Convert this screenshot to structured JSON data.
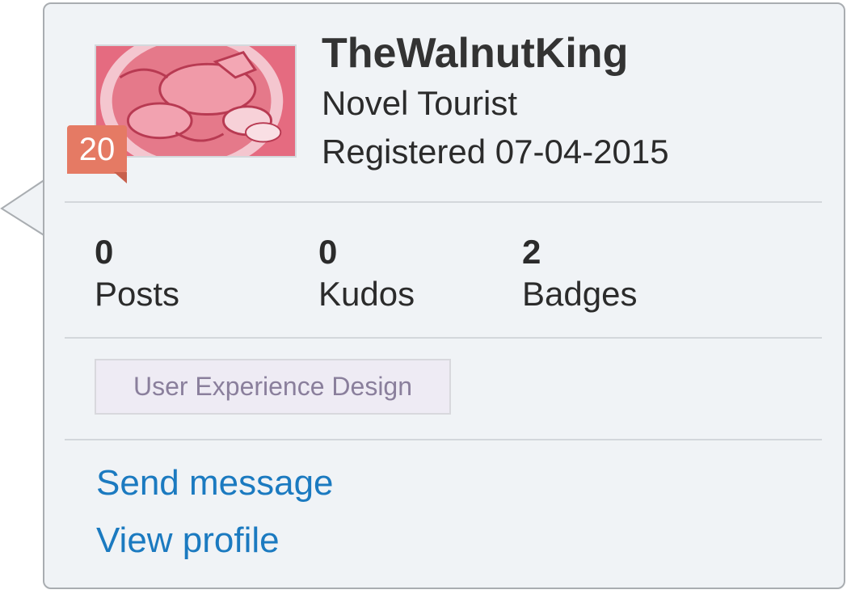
{
  "profile": {
    "username": "TheWalnutKing",
    "rank_title": "Novel Tourist",
    "registered": "Registered 07-04-2015",
    "rank_level": "20"
  },
  "stats": [
    {
      "value": "0",
      "label": "Posts"
    },
    {
      "value": "0",
      "label": "Kudos"
    },
    {
      "value": "2",
      "label": "Badges"
    }
  ],
  "tags": [
    "User Experience Design"
  ],
  "actions": {
    "send_message": "Send message",
    "view_profile": "View profile"
  },
  "colors": {
    "link": "#1b7ac0",
    "badge": "#e57a64",
    "card_background": "#f0f3f6"
  }
}
